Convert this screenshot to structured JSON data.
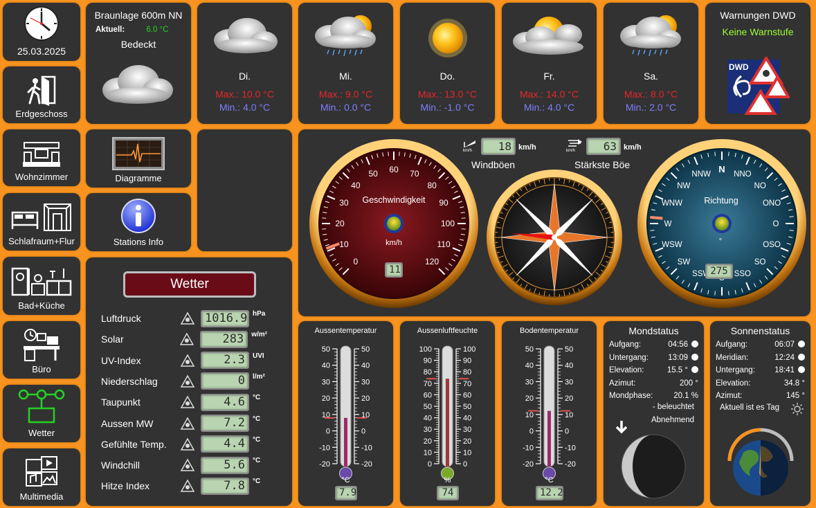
{
  "nav": {
    "clock_date": "25.03.2025",
    "items": [
      {
        "label": "Erdgeschoss"
      },
      {
        "label": "Wohnzimmer"
      },
      {
        "label": "Schlafraum+Flur"
      },
      {
        "label": "Bad+Küche"
      },
      {
        "label": "Büro"
      },
      {
        "label": "Wetter"
      },
      {
        "label": "Multimedia"
      }
    ],
    "diagramme_label": "Diagramme",
    "stations_label": "Stations Info"
  },
  "current": {
    "location": "Braunlage 600m NN",
    "aktuell_label": "Aktuell:",
    "aktuell_value": "6.0 °C",
    "condition": "Bedeckt"
  },
  "forecast": [
    {
      "day": "Di.",
      "max": "Max.: 10.0 °C",
      "min": "Min.: 4.0 °C",
      "icon": "cloud-icon"
    },
    {
      "day": "Mi.",
      "max": "Max.: 9.0 °C",
      "min": "Min.: 0.0 °C",
      "icon": "rain-sun-icon"
    },
    {
      "day": "Do.",
      "max": "Max.: 13.0 °C",
      "min": "Min.: -1.0 °C",
      "icon": "sun-icon"
    },
    {
      "day": "Fr.",
      "max": "Max.: 14.0 °C",
      "min": "Min.: 4.0 °C",
      "icon": "cloud-sun-icon"
    },
    {
      "day": "Sa.",
      "max": "Max.: 8.0 °C",
      "min": "Min.: 2.0 °C",
      "icon": "rain-sun-icon"
    }
  ],
  "warnings": {
    "title": "Warnungen DWD",
    "status": "Keine Warnstufe",
    "logo_text": "DWD"
  },
  "wind": {
    "boeen_value": "18",
    "boeen_unit": "km/h",
    "boeen_label": "Windböen",
    "staerkste_value": "63",
    "staerkste_unit": "km/h",
    "staerkste_label": "Stärkste Böe",
    "icon_unit": "km/h",
    "speed_title": "Geschwindigkeit",
    "speed_unit": "km/h",
    "speed_value": "11",
    "speed_ticks": [
      "0",
      "10",
      "20",
      "30",
      "40",
      "50",
      "60",
      "70",
      "80",
      "90",
      "100",
      "110",
      "120"
    ],
    "speed_level": 11,
    "dir_title": "Richtung",
    "dir_unit": "°",
    "dir_value": "275",
    "dir_labels": [
      "N",
      "NNO",
      "NO",
      "ONO",
      "O",
      "OSO",
      "SO",
      "SSO",
      "S",
      "SSW",
      "SW",
      "WSW",
      "W",
      "WNW",
      "NW",
      "NNW"
    ],
    "dir_level": 275
  },
  "wetter": {
    "title": "Wetter",
    "rows": [
      {
        "label": "Luftdruck",
        "value": "1016.9",
        "unit": "hPa",
        "icon": "barometer-icon"
      },
      {
        "label": "Solar",
        "value": "283",
        "unit": "w/m²",
        "icon": "solar-icon"
      },
      {
        "label": "UV-Index",
        "value": "2.3",
        "unit": "UVI",
        "icon": "uv-icon"
      },
      {
        "label": "Niederschlag",
        "value": "0",
        "unit": "l/m²",
        "icon": "rain-gauge-icon"
      },
      {
        "label": "Taupunkt",
        "value": "4.6",
        "unit": "°C",
        "icon": "dewpoint-icon"
      },
      {
        "label": "Aussen MW",
        "value": "7.2",
        "unit": "°C",
        "icon": "thermometer-icon"
      },
      {
        "label": "Gefühlte Temp.",
        "value": "4.4",
        "unit": "°C",
        "icon": "feels-like-icon"
      },
      {
        "label": "Windchill",
        "value": "5.6",
        "unit": "°C",
        "icon": "windchill-icon"
      },
      {
        "label": "Hitze Index",
        "value": "7.8",
        "unit": "°C",
        "icon": "heat-index-icon"
      }
    ]
  },
  "thermometers": [
    {
      "title": "Aussentemperatur",
      "unit": "°C",
      "value": "7.9",
      "ticks": [
        "50",
        "40",
        "30",
        "20",
        "10",
        "0",
        "-10",
        "-20"
      ],
      "min": -20,
      "max": 50,
      "level": 7.9,
      "color": "#9c2a6c",
      "bulb": "#6a4aa8"
    },
    {
      "title": "Aussenluftfeuchte",
      "unit": "%",
      "value": "74",
      "ticks": [
        "100",
        "90",
        "80",
        "70",
        "60",
        "50",
        "40",
        "30",
        "20",
        "10",
        "0"
      ],
      "min": 0,
      "max": 100,
      "level": 74,
      "color": "#9c3a3a",
      "bulb": "#7aa82a"
    },
    {
      "title": "Bodentemperatur",
      "unit": "°C",
      "value": "12.2",
      "ticks": [
        "50",
        "40",
        "30",
        "20",
        "10",
        "0",
        "-10",
        "-20"
      ],
      "min": -20,
      "max": 50,
      "level": 12.2,
      "color": "#9c2a6c",
      "bulb": "#6a4aa8"
    }
  ],
  "mond": {
    "title": "Mondstatus",
    "rows": [
      {
        "label": "Aufgang:",
        "value": "04:56"
      },
      {
        "label": "Untergang:",
        "value": "13:09"
      },
      {
        "label": "Elevation:",
        "value": "15.5 °"
      },
      {
        "label": "Azimut:",
        "value": "200 °"
      },
      {
        "label": "Mondphase:",
        "value": "20.1 %"
      }
    ],
    "beleuchtet": "- beleuchtet",
    "phase_name": "Abnehmend"
  },
  "sonne": {
    "title": "Sonnenstatus",
    "rows": [
      {
        "label": "Aufgang:",
        "value": "06:07"
      },
      {
        "label": "Meridian:",
        "value": "12:24"
      },
      {
        "label": "Untergang:",
        "value": "18:41"
      },
      {
        "label": "Elevation:",
        "value": "34.8 °"
      },
      {
        "label": "Azimut:",
        "value": "145 °"
      }
    ],
    "tag_text": "Aktuell ist es Tag"
  },
  "colors": {
    "background": "#f7931e",
    "tile": "#323232",
    "max": "#e8262a",
    "min": "#7f7fff",
    "active": "#24d324"
  }
}
